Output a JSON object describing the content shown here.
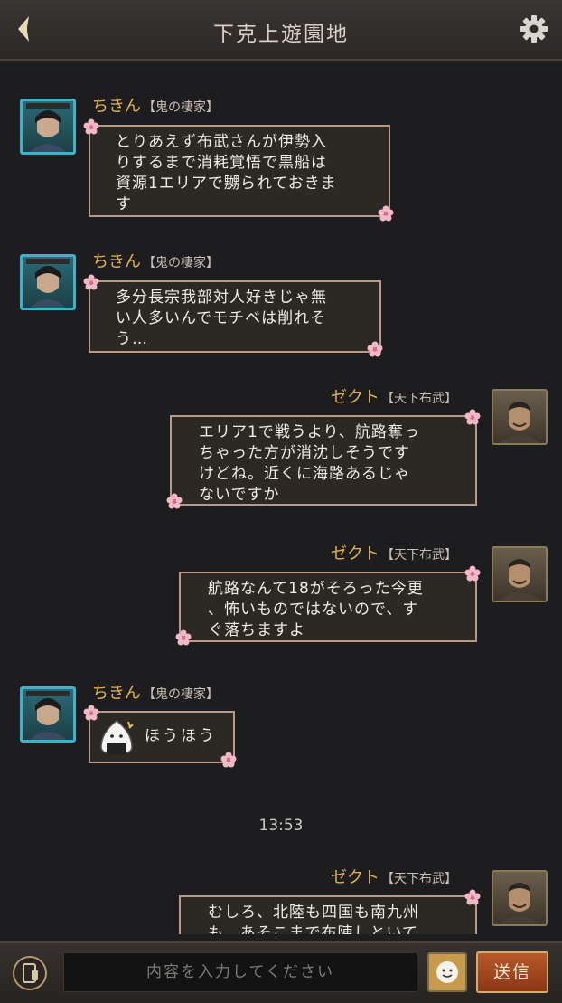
{
  "header": {
    "title": "下克上遊園地"
  },
  "messages": [
    {
      "sender": "ちきん",
      "tag": "【鬼の棲家】",
      "text": "とりあえず布武さんが伊勢入\nりするまで消耗覚悟で黒船は\n資源1エリアで嬲られておきま\nす"
    },
    {
      "sender": "ちきん",
      "tag": "【鬼の棲家】",
      "text": "多分長宗我部対人好きじゃ無\nい人多いんでモチベは削れそ\nう…"
    },
    {
      "sender": "ゼクト",
      "tag": "【天下布武】",
      "text": "エリア1で戦うより、航路奪っ\nちゃった方が消沈しそうです\nけどね。近くに海路あるじゃ\nないですか"
    },
    {
      "sender": "ゼクト",
      "tag": "【天下布武】",
      "text": "航路なんて18がそろった今更\n、怖いものではないので、す\nぐ落ちますよ"
    },
    {
      "sender": "ちきん",
      "tag": "【鬼の棲家】",
      "text": "ほうほう"
    },
    {
      "sender": "ゼクト",
      "tag": "【天下布武】",
      "text": "むしろ、北陸も四国も南九州\nも、あそこまで布陣しといて"
    }
  ],
  "timestamp": "13:53",
  "input": {
    "placeholder": "内容を入力してください"
  },
  "send_label": "送信",
  "colors": {
    "sender_name": "#e0b24a",
    "bubble_border": "#b99a86",
    "send_button": "#a4481f"
  }
}
